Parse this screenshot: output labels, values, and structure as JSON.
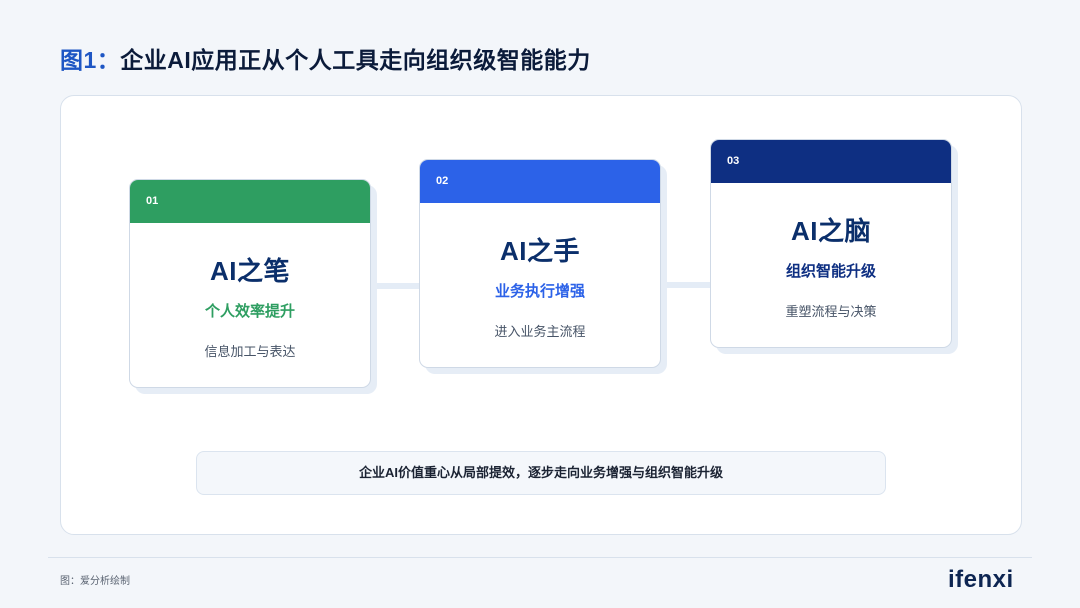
{
  "title": {
    "prefix": "图1：",
    "text": "企业AI应用正从个人工具走向组织级智能能力"
  },
  "cards": [
    {
      "num": "01",
      "name": "AI之笔",
      "subtitle": "个人效率提升",
      "desc": "信息加工与表达",
      "color": "#2e9e61"
    },
    {
      "num": "02",
      "name": "AI之手",
      "subtitle": "业务执行增强",
      "desc": "进入业务主流程",
      "color": "#2c62e8"
    },
    {
      "num": "03",
      "name": "AI之脑",
      "subtitle": "组织智能升级",
      "desc": "重塑流程与决策",
      "color": "#0e2f82"
    }
  ],
  "summary": "企业AI价值重心从局部提效，逐步走向业务增强与组织智能升级",
  "source": "图：爱分析绘制",
  "logo": "ifenxi"
}
